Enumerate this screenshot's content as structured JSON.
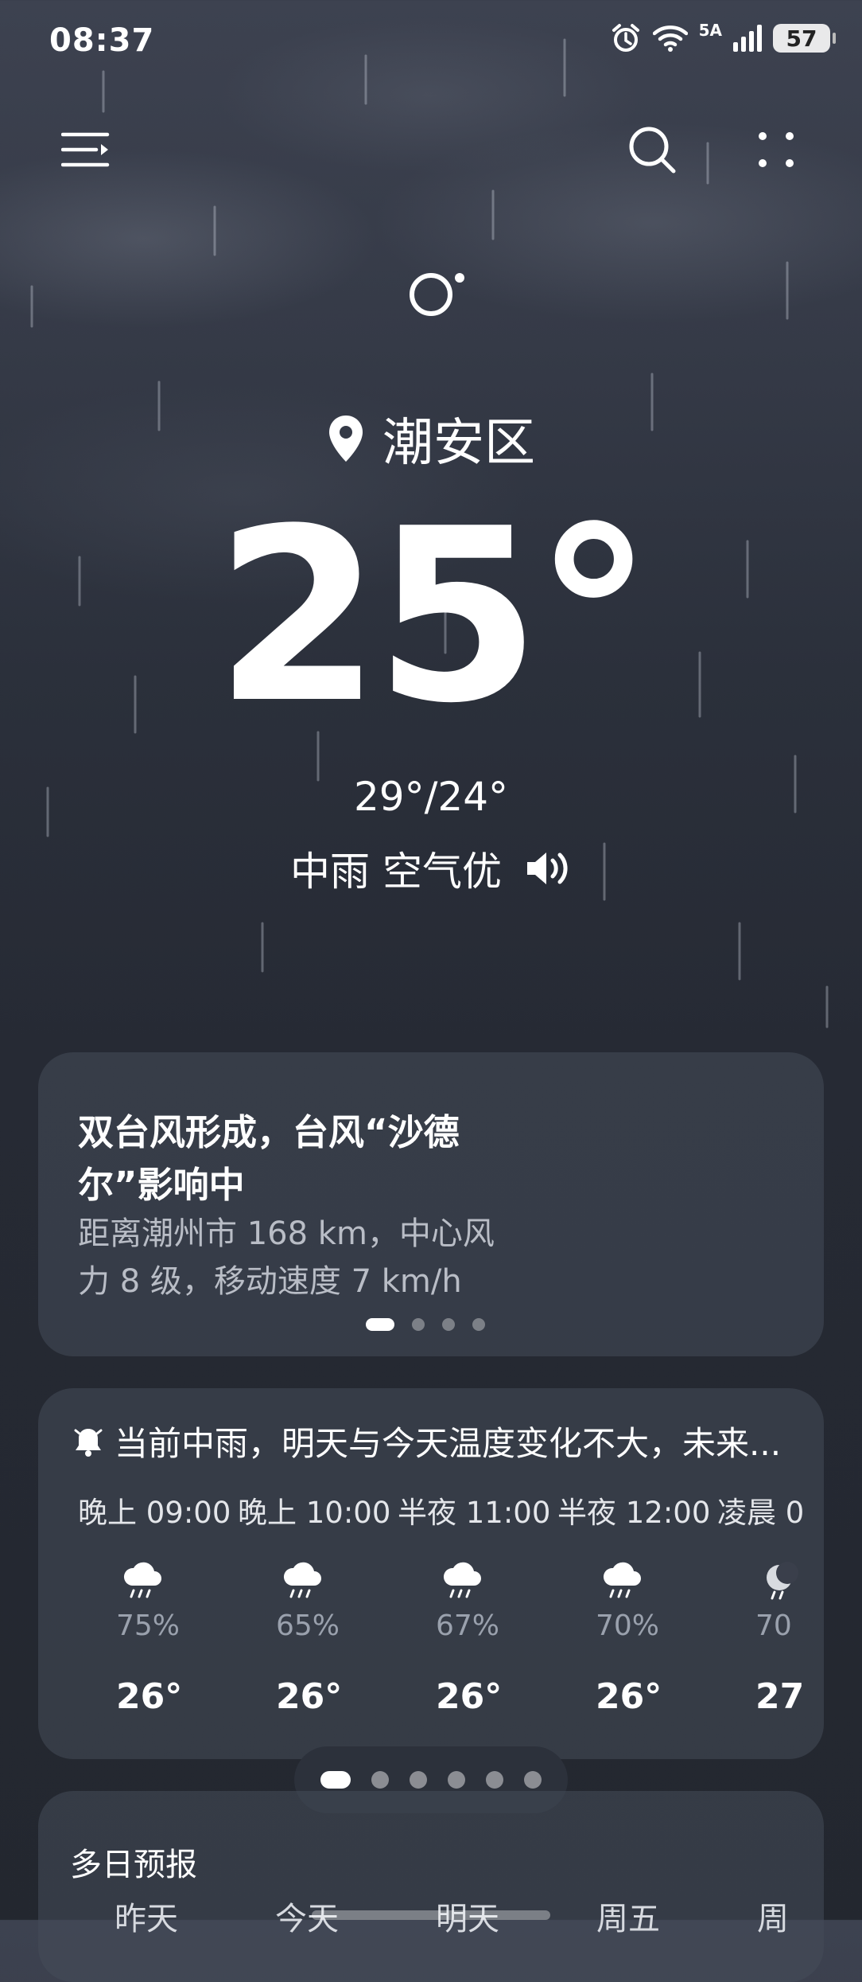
{
  "status_bar": {
    "time": "08:37",
    "network_label": "5A",
    "battery": "57"
  },
  "location": {
    "name": "潮安区"
  },
  "current": {
    "temperature": "25°",
    "high_low": "29°/24°",
    "condition": "中雨 空气优"
  },
  "alert": {
    "title": "双台风形成，台风“沙德尔”影响中",
    "description": "距离潮州市 168 km，中心风力 8 级，移动速度 7 km/h",
    "page_count": 4,
    "active_page": 1
  },
  "hourly": {
    "summary": "当前中雨，明天与今天温度变化不大，未来...",
    "hours": [
      {
        "time": "晚上 09:00",
        "icon": "rain-cloud-icon",
        "precip": "75%",
        "temp": "26°"
      },
      {
        "time": "晚上 10:00",
        "icon": "rain-cloud-icon",
        "precip": "65%",
        "temp": "26°"
      },
      {
        "time": "半夜 11:00",
        "icon": "rain-cloud-icon",
        "precip": "67%",
        "temp": "26°"
      },
      {
        "time": "半夜 12:00",
        "icon": "rain-cloud-icon",
        "precip": "70%",
        "temp": "26°"
      },
      {
        "time": "凌晨 0",
        "icon": "moon-rain-icon",
        "precip": "70",
        "temp": "27"
      }
    ]
  },
  "pager": {
    "count": 6,
    "active": 1
  },
  "multi_day": {
    "title": "多日预报",
    "days": [
      "昨天",
      "今天",
      "明天",
      "周五",
      "周"
    ]
  },
  "colors": {
    "background_top": "#3d4250",
    "background_bottom": "#23272f",
    "card": "#464c5a",
    "secondary_text": "#b9bdc6"
  }
}
